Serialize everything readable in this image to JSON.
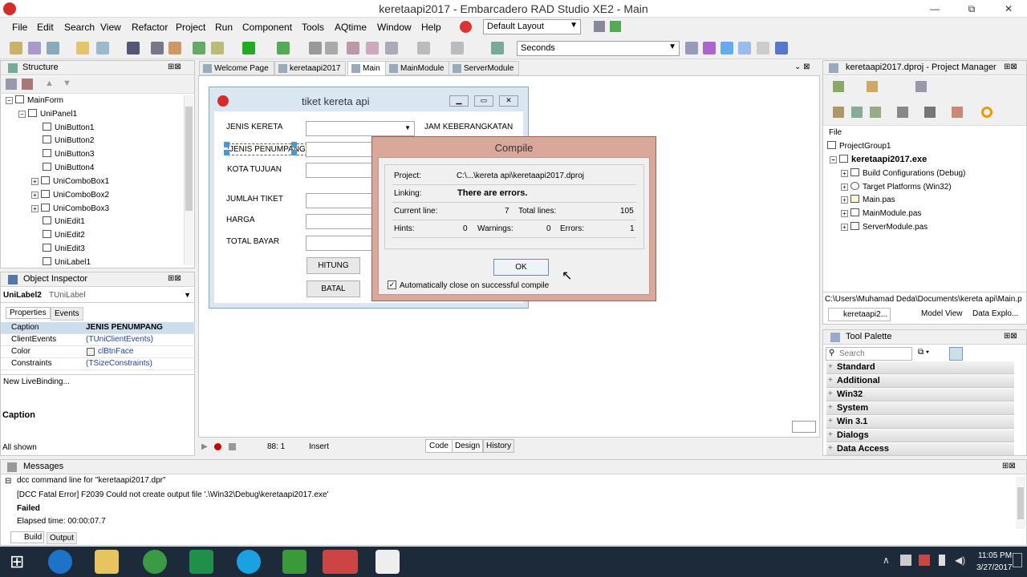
{
  "window": {
    "title": "keretaapi2017 - Embarcadero RAD Studio XE2 - Main",
    "btns": [
      "—",
      "⧉",
      "✕"
    ]
  },
  "menu": [
    "File",
    "Edit",
    "Search",
    "View",
    "Refactor",
    "Project",
    "Run",
    "Component",
    "Tools",
    "AQtime",
    "Window",
    "Help"
  ],
  "toolbar": {
    "layout": "Default Layout",
    "units": "Seconds"
  },
  "structure": {
    "title": "Structure",
    "items": [
      "MainForm",
      "UniPanel1",
      "UniButton1",
      "UniButton2",
      "UniButton3",
      "UniButton4",
      "UniComboBox1",
      "UniComboBox2",
      "UniComboBox3",
      "UniEdit1",
      "UniEdit2",
      "UniEdit3",
      "UniLabel1"
    ]
  },
  "inspector": {
    "title": "Object Inspector",
    "selected": "UniLabel2",
    "selected_type": "TUniLabel",
    "tabs": [
      "Properties",
      "Events"
    ],
    "rows": [
      {
        "k": "Caption",
        "v": "JENIS PENUMPANG"
      },
      {
        "k": "ClientEvents",
        "v": "(TUniClientEvents)"
      },
      {
        "k": "Color",
        "v": "clBtnFace"
      },
      {
        "k": "Constraints",
        "v": "(TSizeConstraints)"
      }
    ],
    "livebinding": "New LiveBinding...",
    "desc_title": "Caption",
    "footer": "All shown"
  },
  "tabs": [
    "Welcome Page",
    "keretaapi2017",
    "Main",
    "MainModule",
    "ServerModule"
  ],
  "form": {
    "title": "tiket kereta api",
    "labels": [
      "JENIS KERETA",
      "JENIS PENUMPANG",
      "KOTA TUJUAN",
      "JUMLAH TIKET",
      "HARGA",
      "TOTAL BAYAR",
      "JAM KEBERANGKATAN"
    ],
    "buttons": [
      "HITUNG",
      "BATAL"
    ]
  },
  "compile": {
    "title": "Compile",
    "project_label": "Project:",
    "project_value": "C:\\...\\kereta api\\keretaapi2017.dproj",
    "linking_label": "Linking:",
    "linking_value": "There are errors.",
    "current_line_label": "Current line:",
    "current_line": "7",
    "total_lines_label": "Total lines:",
    "total_lines": "105",
    "hints_label": "Hints:",
    "hints": "0",
    "warnings_label": "Warnings:",
    "warnings": "0",
    "errors_label": "Errors:",
    "errors": "1",
    "ok": "OK",
    "autoclose": "Automatically close on successful compile"
  },
  "editor_status": {
    "pos": "88: 1",
    "mode": "Insert",
    "tabs": [
      "Code",
      "Design",
      "History"
    ]
  },
  "project_manager": {
    "title": "keretaapi2017.dproj - Project Manager",
    "col": "File",
    "items": [
      "ProjectGroup1",
      "keretaapi2017.exe",
      "Build Configurations (Debug)",
      "Target Platforms (Win32)",
      "Main.pas",
      "MainModule.pas",
      "ServerModule.pas"
    ],
    "path": "C:\\Users\\Muhamad Deda\\Documents\\kereta api\\Main.p",
    "tabs": [
      "keretaapi2...",
      "Model View",
      "Data Explo..."
    ]
  },
  "palette": {
    "title": "Tool Palette",
    "search": "Search",
    "cats": [
      "Standard",
      "Additional",
      "Win32",
      "System",
      "Win 3.1",
      "Dialogs",
      "Data Access"
    ]
  },
  "messages": {
    "title": "Messages",
    "lines": [
      "dcc command line for \"keretaapi2017.dpr\"",
      "[DCC Fatal Error] F2039 Could not create output file '.\\Win32\\Debug\\keretaapi2017.exe'",
      "Failed",
      "Elapsed time: 00:00:07.7"
    ],
    "tabs": [
      "Build",
      "Output"
    ]
  },
  "clock": {
    "time": "11:05 PM",
    "date": "3/27/2017"
  },
  "colors": {
    "accent": "#d62b2b",
    "dialog_border": "#d9a89a",
    "taskbar": "#1c2a3a"
  }
}
